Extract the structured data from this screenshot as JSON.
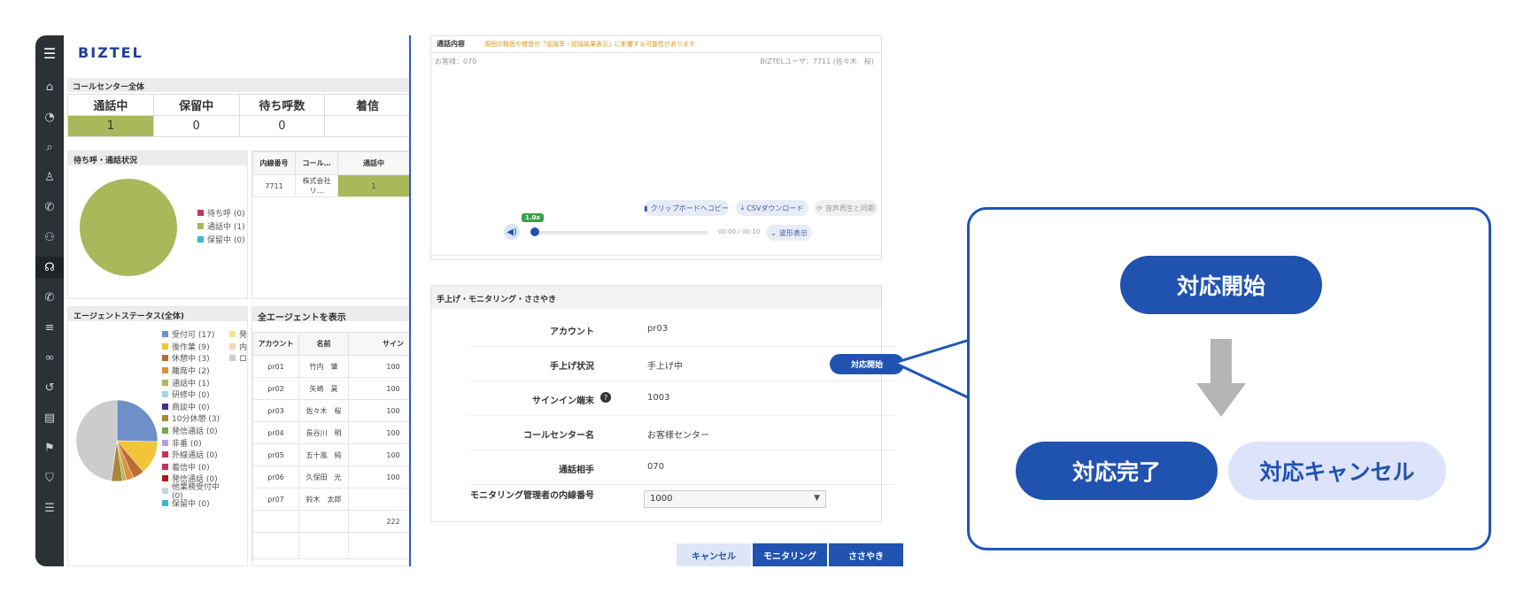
{
  "logo": "BIZTEL",
  "callcenter": {
    "title": "コールセンター全体",
    "headers": [
      "通話中",
      "保留中",
      "待ち呼数",
      "着信"
    ],
    "values": [
      "1",
      "0",
      "0",
      ""
    ]
  },
  "pie_panel": {
    "title": "待ち呼・通話状況",
    "legend": [
      {
        "label": "待ち呼 (0)",
        "color": "#c2365a"
      },
      {
        "label": "通話中 (1)",
        "color": "#a9b85a"
      },
      {
        "label": "保留中 (0)",
        "color": "#3fb6c9"
      }
    ]
  },
  "ext_table": {
    "headers": [
      "内線番号",
      "コール…",
      "通話中"
    ],
    "row": [
      "7711",
      "株式会社リ…",
      "1"
    ]
  },
  "agent_status": {
    "title": "エージェントステータス(全体)",
    "legend": [
      {
        "label": "受付可 (17)",
        "color": "#6f8fc8"
      },
      {
        "label": "後作業 (9)",
        "color": "#f2c438"
      },
      {
        "label": "休憩中 (3)",
        "color": "#b86d33"
      },
      {
        "label": "離席中 (2)",
        "color": "#e08e3a"
      },
      {
        "label": "通話中 (1)",
        "color": "#a9b85a"
      },
      {
        "label": "研修中 (0)",
        "color": "#9fd6e0"
      },
      {
        "label": "商談中 (0)",
        "color": "#4b2a87"
      },
      {
        "label": "10分休憩 (3)",
        "color": "#a9883a"
      },
      {
        "label": "発信通話 (0)",
        "color": "#6fa84a"
      },
      {
        "label": "非番 (0)",
        "color": "#b89be0"
      },
      {
        "label": "外線通話 (0)",
        "color": "#c2365a"
      },
      {
        "label": "着信中 (0)",
        "color": "#c2365a"
      },
      {
        "label": "発信通話 (0)",
        "color": "#a81c1c"
      },
      {
        "label": "他業務受付中 (0)",
        "color": "#c8cde8"
      },
      {
        "label": "保留中 (0)",
        "color": "#3fb6c9"
      }
    ],
    "legend2": [
      {
        "label": "発",
        "color": "#f2e39a"
      },
      {
        "label": "内",
        "color": "#f2d9b5"
      },
      {
        "label": "ロ",
        "color": "#cccccc"
      }
    ]
  },
  "agents": {
    "title": "全エージェントを表示",
    "headers": [
      "アカウント",
      "名前",
      "サイン"
    ],
    "rows": [
      [
        "pr01",
        "竹内　肇",
        "100"
      ],
      [
        "pr02",
        "矢崎　昊",
        "100"
      ],
      [
        "pr03",
        "佐々木　桜",
        "100"
      ],
      [
        "pr04",
        "長谷川　明",
        "100"
      ],
      [
        "pr05",
        "五十嵐　純",
        "100"
      ],
      [
        "pr06",
        "久保田　光",
        "100"
      ],
      [
        "pr07",
        "鈴木　太郎",
        ""
      ]
    ],
    "footer": "222"
  },
  "call_content": {
    "title": "通話内容",
    "warning": "周囲の騒音や雑音が「認識率・認識結果表示」に影響する可能性があります",
    "customer": "お客様：070",
    "user": "BIZTELユーザ：7711 (佐々木　桜)",
    "clipboard": "クリップボードへコピー",
    "csv": "CSVダウンロード",
    "sync": "音声再生と同期",
    "speed": "1.0x",
    "time": "00:00 / 00:10",
    "wave": "波形表示"
  },
  "monitor": {
    "title": "手上げ・モニタリング・ささやき",
    "rows": [
      {
        "label": "アカウント",
        "value": "pr03"
      },
      {
        "label": "手上げ状況",
        "value": "手上げ中"
      },
      {
        "label": "サインイン端末",
        "value": "1003"
      },
      {
        "label": "コールセンター名",
        "value": "お客様センター"
      },
      {
        "label": "通話相手",
        "value": "070"
      },
      {
        "label": "モニタリング管理者の内線番号",
        "value": "1000"
      }
    ],
    "start_button": "対応開始"
  },
  "footer_buttons": {
    "cancel": "キャンセル",
    "monitoring": "モニタリング",
    "whisper": "ささやき"
  },
  "callout": {
    "start": "対応開始",
    "complete": "対応完了",
    "cancel": "対応キャンセル"
  }
}
